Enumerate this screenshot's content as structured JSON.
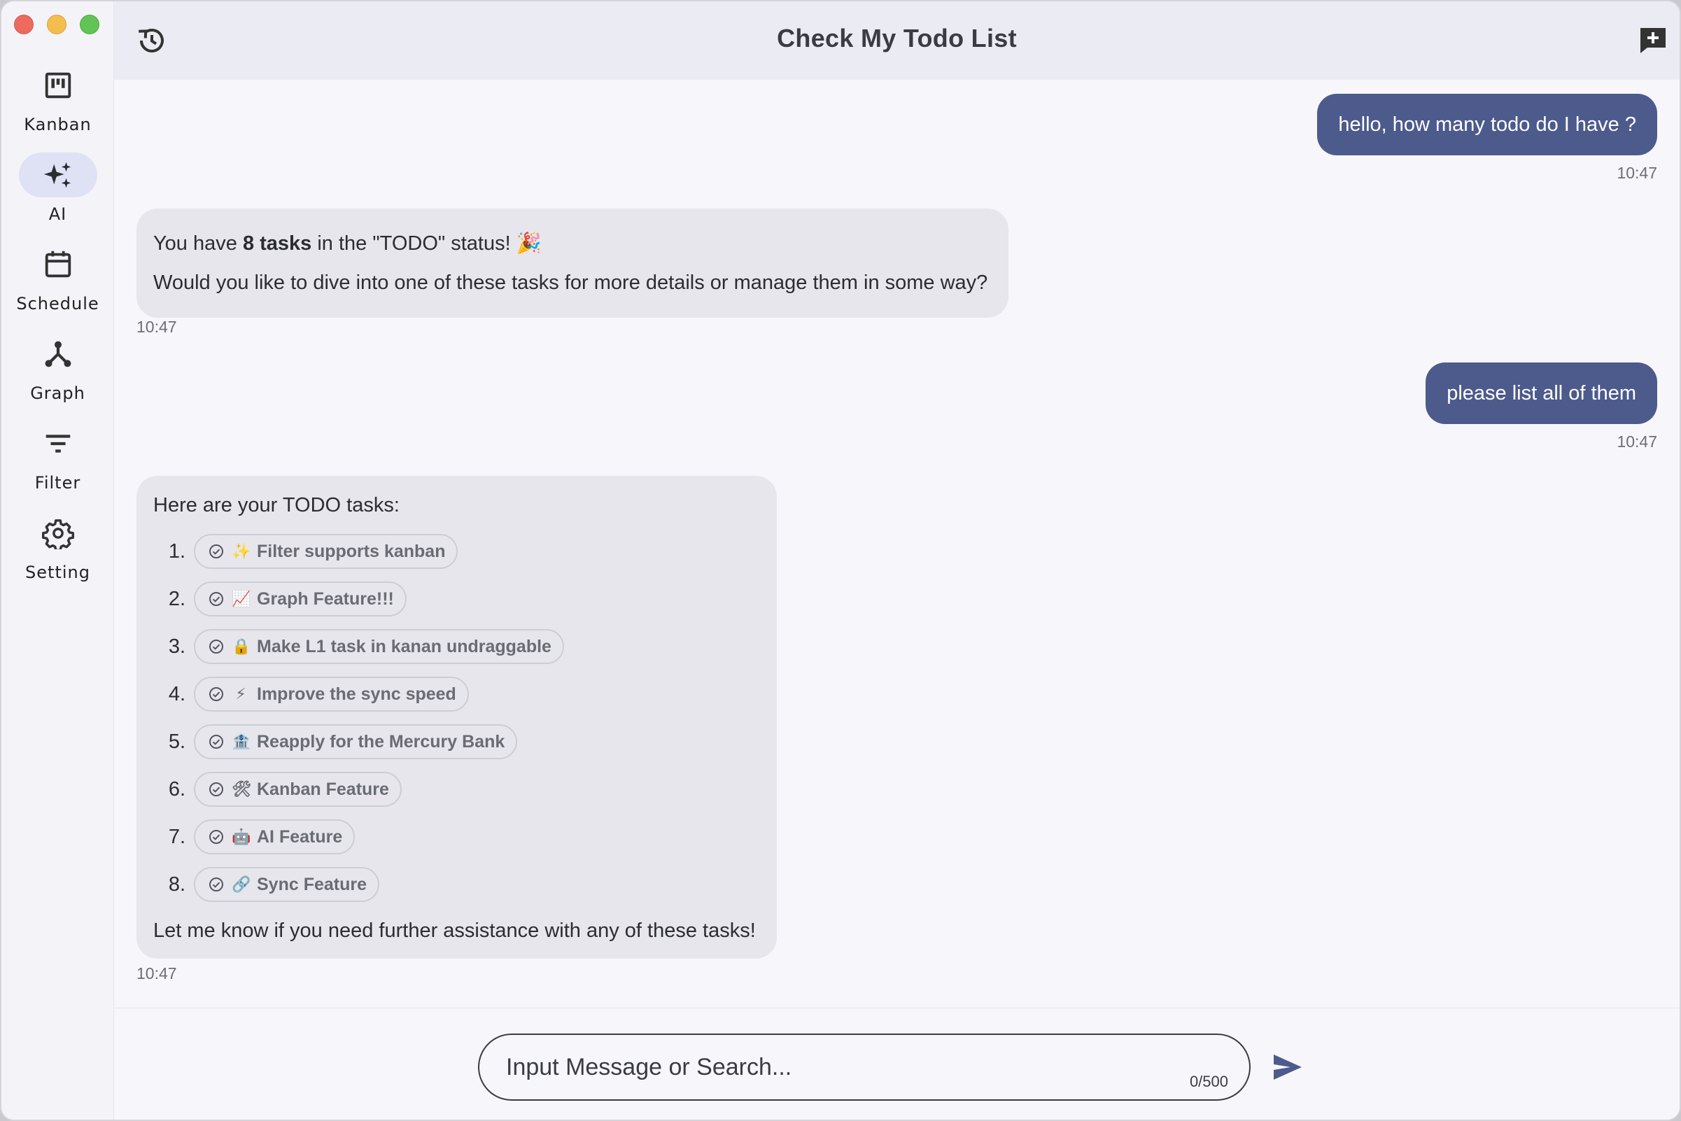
{
  "window": {
    "title": "Check My Todo List"
  },
  "sidebar": {
    "items": [
      {
        "label": "Kanban",
        "icon": "kanban-icon",
        "active": false
      },
      {
        "label": "AI",
        "icon": "sparkles-icon",
        "active": true
      },
      {
        "label": "Schedule",
        "icon": "calendar-icon",
        "active": false
      },
      {
        "label": "Graph",
        "icon": "graph-icon",
        "active": false
      },
      {
        "label": "Filter",
        "icon": "filter-icon",
        "active": false
      },
      {
        "label": "Setting",
        "icon": "gear-icon",
        "active": false
      }
    ]
  },
  "messages": [
    {
      "role": "user",
      "text": "hello, how many todo do I have ?",
      "time": "10:47"
    },
    {
      "role": "ai",
      "line1_prefix": "You have ",
      "line1_bold": "8 tasks",
      "line1_suffix": " in the \"TODO\" status! 🎉",
      "line2": "Would you like to dive into one of these tasks for more details or manage them in some way?",
      "time": "10:47"
    },
    {
      "role": "user",
      "text": "please list all of them",
      "time": "10:47"
    },
    {
      "role": "ai",
      "intro": "Here are your TODO tasks:",
      "tasks": [
        {
          "num": "1.",
          "emoji": "✨",
          "label": "Filter supports kanban"
        },
        {
          "num": "2.",
          "emoji": "📈",
          "label": "Graph Feature!!!"
        },
        {
          "num": "3.",
          "emoji": "🔒",
          "label": "Make L1 task in kanan undraggable"
        },
        {
          "num": "4.",
          "emoji": "⚡",
          "label": "Improve the sync speed"
        },
        {
          "num": "5.",
          "emoji": "🏦",
          "label": "Reapply for the Mercury Bank"
        },
        {
          "num": "6.",
          "emoji": "🛠",
          "label": "Kanban Feature"
        },
        {
          "num": "7.",
          "emoji": "🤖",
          "label": "AI Feature"
        },
        {
          "num": "8.",
          "emoji": "🔗",
          "label": "Sync Feature"
        }
      ],
      "outro": "Let me know if you need further assistance with any of these tasks!",
      "time": "10:47"
    }
  ],
  "composer": {
    "placeholder": "Input Message or Search...",
    "counter": "0/500"
  },
  "colors": {
    "user_bubble": "#4d5a8c",
    "ai_bubble": "#e6e6ec",
    "active_nav": "#dfe1f5",
    "send": "#4d5a8c"
  }
}
